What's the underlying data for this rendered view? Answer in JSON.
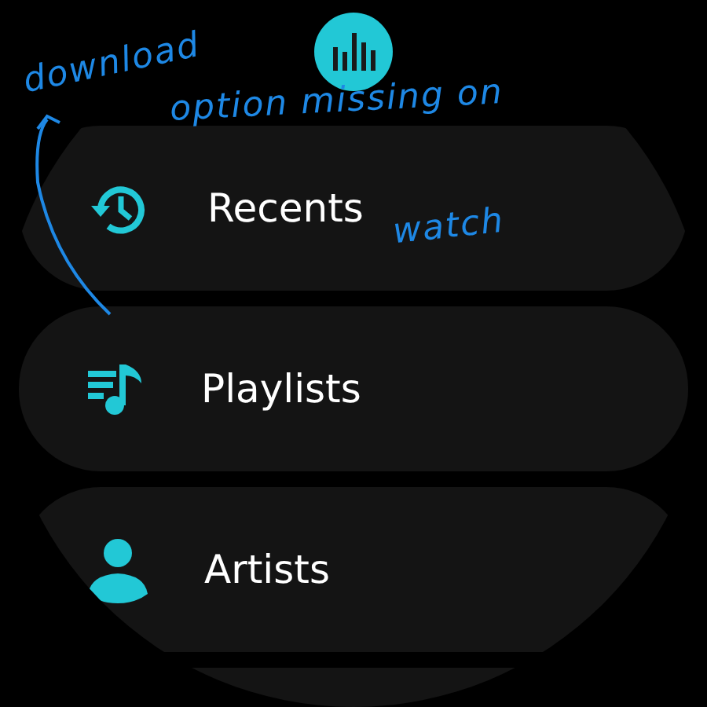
{
  "menu_items": [
    {
      "kind": "recents",
      "label": "Recents"
    },
    {
      "kind": "playlists",
      "label": "Playlists"
    },
    {
      "kind": "artists",
      "label": "Artists"
    },
    {
      "kind": "more"
    }
  ],
  "annotations": [
    {
      "text": "download"
    },
    {
      "text": "option missing on"
    },
    {
      "text": "watch"
    }
  ]
}
